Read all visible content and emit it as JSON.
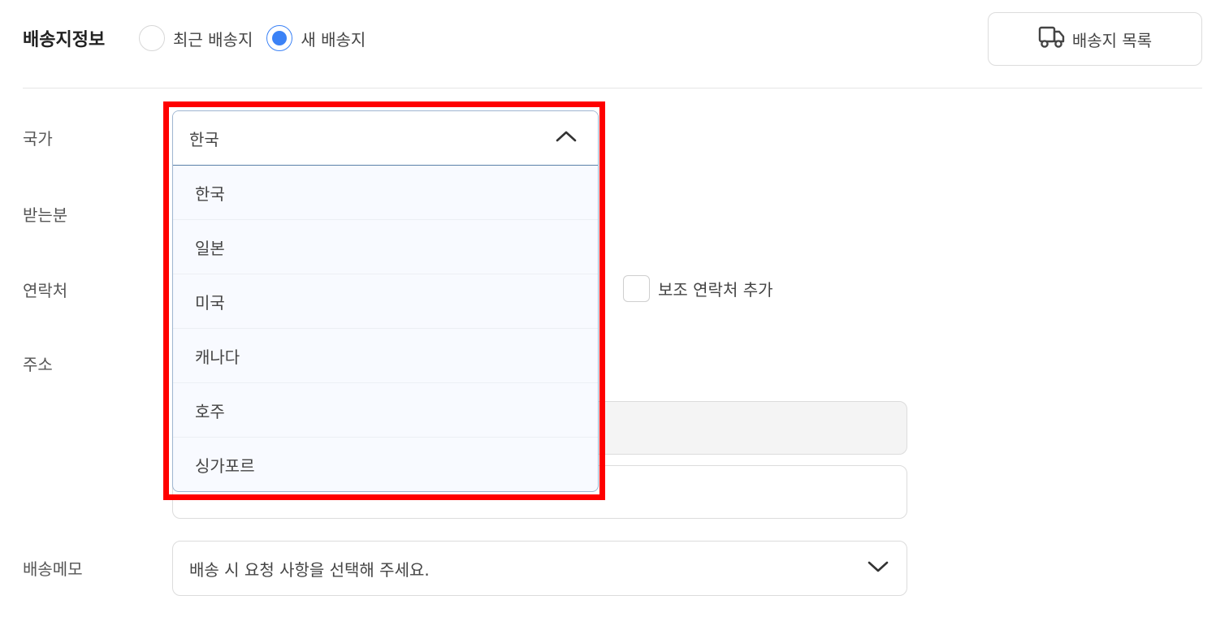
{
  "header": {
    "title": "배송지정보",
    "radio_options": [
      {
        "label": "최근 배송지",
        "checked": false
      },
      {
        "label": "새 배송지",
        "checked": true
      }
    ],
    "address_list_button": "배송지 목록"
  },
  "labels": {
    "country": "국가",
    "recipient": "받는분",
    "contact": "연락처",
    "address": "주소",
    "memo": "배송메모"
  },
  "country_select": {
    "selected": "한국",
    "options": [
      "한국",
      "일본",
      "미국",
      "캐나다",
      "호주",
      "싱가포르"
    ]
  },
  "contact": {
    "secondary_checkbox_label": "보조 연락처 추가"
  },
  "memo_select": {
    "placeholder": "배송 시 요청 사항을 선택해 주세요."
  },
  "colors": {
    "accent": "#3b82f6",
    "highlight": "#ff0000"
  }
}
